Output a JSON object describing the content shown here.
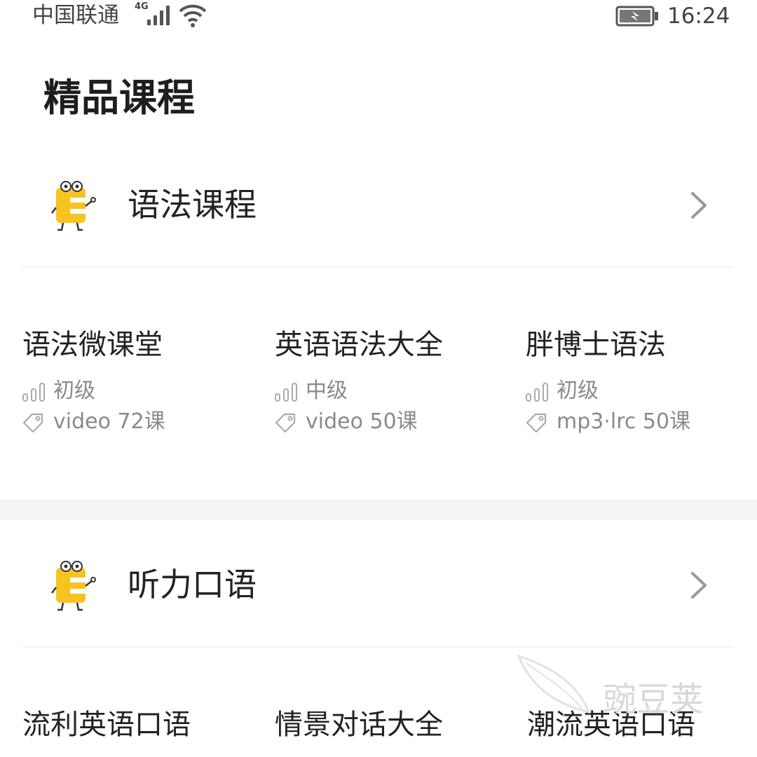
{
  "status_bar": {
    "carrier": "中国联通",
    "network": "4G",
    "time": "16:24",
    "icons": [
      "signal-icon",
      "wifi-icon",
      "battery-charging-icon"
    ]
  },
  "page": {
    "title": "精品课程"
  },
  "sections": [
    {
      "title": "语法课程",
      "icon": "mascot-icon",
      "courses": [
        {
          "title": "语法微课堂",
          "level": "初级",
          "format": "video 72课"
        },
        {
          "title": "英语语法大全",
          "level": "中级",
          "format": "video 50课"
        },
        {
          "title": "胖博士语法",
          "level": "初级",
          "format": "mp3·lrc 50课"
        }
      ]
    },
    {
      "title": "听力口语",
      "icon": "mascot-icon",
      "courses": [
        {
          "title": "流利英语口语"
        },
        {
          "title": "情景对话大全"
        },
        {
          "title": "潮流英语口语"
        }
      ]
    }
  ],
  "watermark": {
    "text": "豌豆荚"
  },
  "colors": {
    "mascot_yellow": "#F9C31F",
    "text_primary": "#222222",
    "text_secondary": "#8a8a8a",
    "section_gap": "#f5f5f5"
  }
}
